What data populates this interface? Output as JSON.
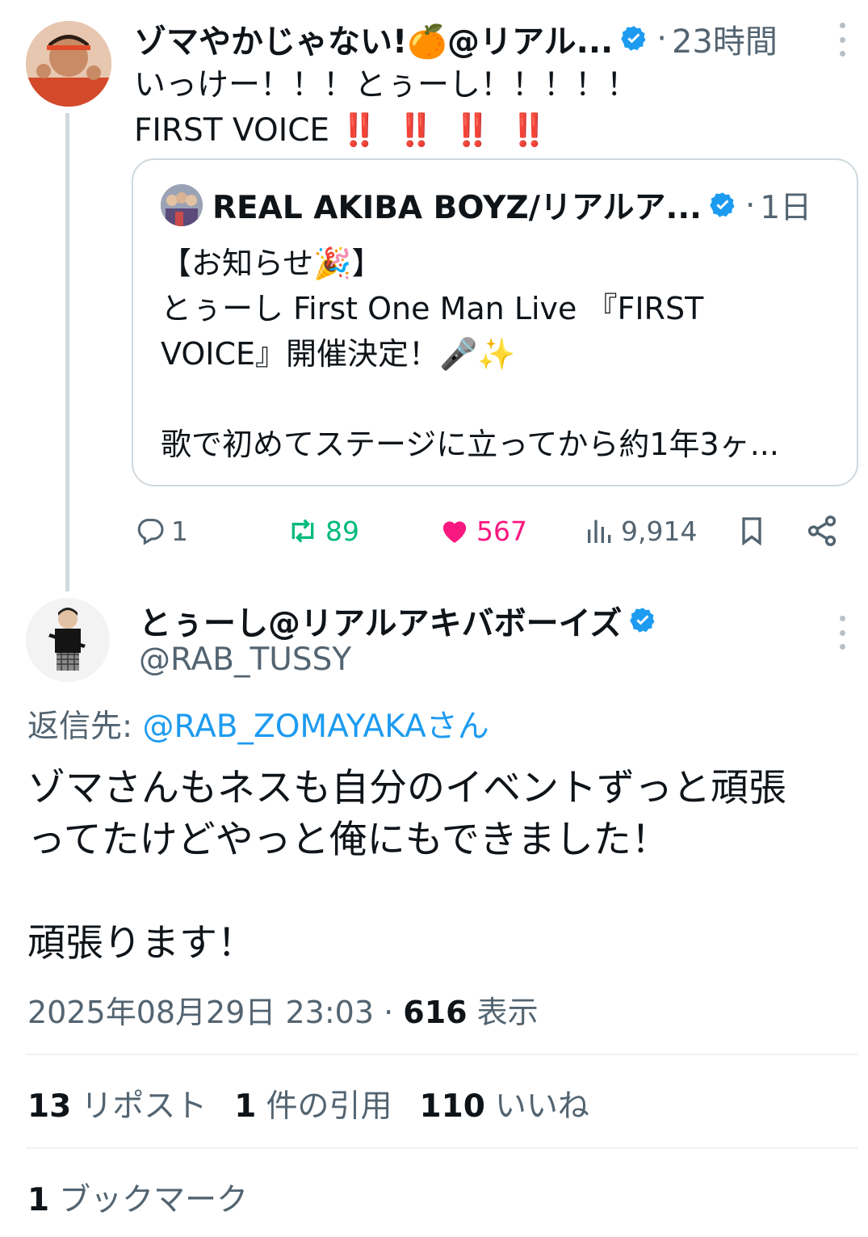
{
  "parent_tweet": {
    "display_name": "ゾマやかじゃない!🍊@リアル...",
    "time_sep": "·",
    "time": "23時間",
    "text_line1": "いっけー！！！とぅーし！！！！！",
    "text_line2": "FIRST VOICE",
    "bangs": "‼️ ‼️ ‼️ ‼️",
    "quote": {
      "display_name": "REAL AKIBA BOYZ/リアルア...",
      "time_sep": "·",
      "time": "1日",
      "text": "【お知らせ🎉】\nとぅーし First One Man Live 『FIRST\nVOICE』開催決定！🎤✨\n\n歌で初めてステージに立ってから約1年3ヶ..."
    },
    "actions": {
      "replies": "1",
      "reposts": "89",
      "likes": "567",
      "views": "9,914"
    }
  },
  "main_tweet": {
    "display_name": "とぅーし@リアルアキバボーイズ",
    "handle": "@RAB_TUSSY",
    "reply_prefix": "返信先: ",
    "reply_mention": "@RAB_ZOMAYAKAさん",
    "text": "ゾマさんもネスも自分のイベントずっと頑張\nってたけどやっと俺にもできました！\n\n頑張ります！",
    "timestamp": "2025年08月29日 23:03",
    "meta_sep": " · ",
    "view_count": "616",
    "view_label": " 表示",
    "stats": {
      "reposts_count": "13",
      "reposts_label": "リポスト",
      "quotes_count": "1",
      "quotes_label": "件の引用",
      "likes_count": "110",
      "likes_label": "いいね",
      "bookmarks_count": "1",
      "bookmarks_label": "ブックマーク"
    }
  },
  "colors": {
    "verified": "#1d9bf0",
    "repost": "#00ba7c",
    "like": "#f91880",
    "secondary_text": "#536471",
    "link": "#1d9bf0"
  },
  "icons": [
    "verified-badge-icon",
    "more-icon",
    "reply-icon",
    "repost-icon",
    "like-icon",
    "views-icon",
    "bookmark-icon",
    "share-icon"
  ]
}
